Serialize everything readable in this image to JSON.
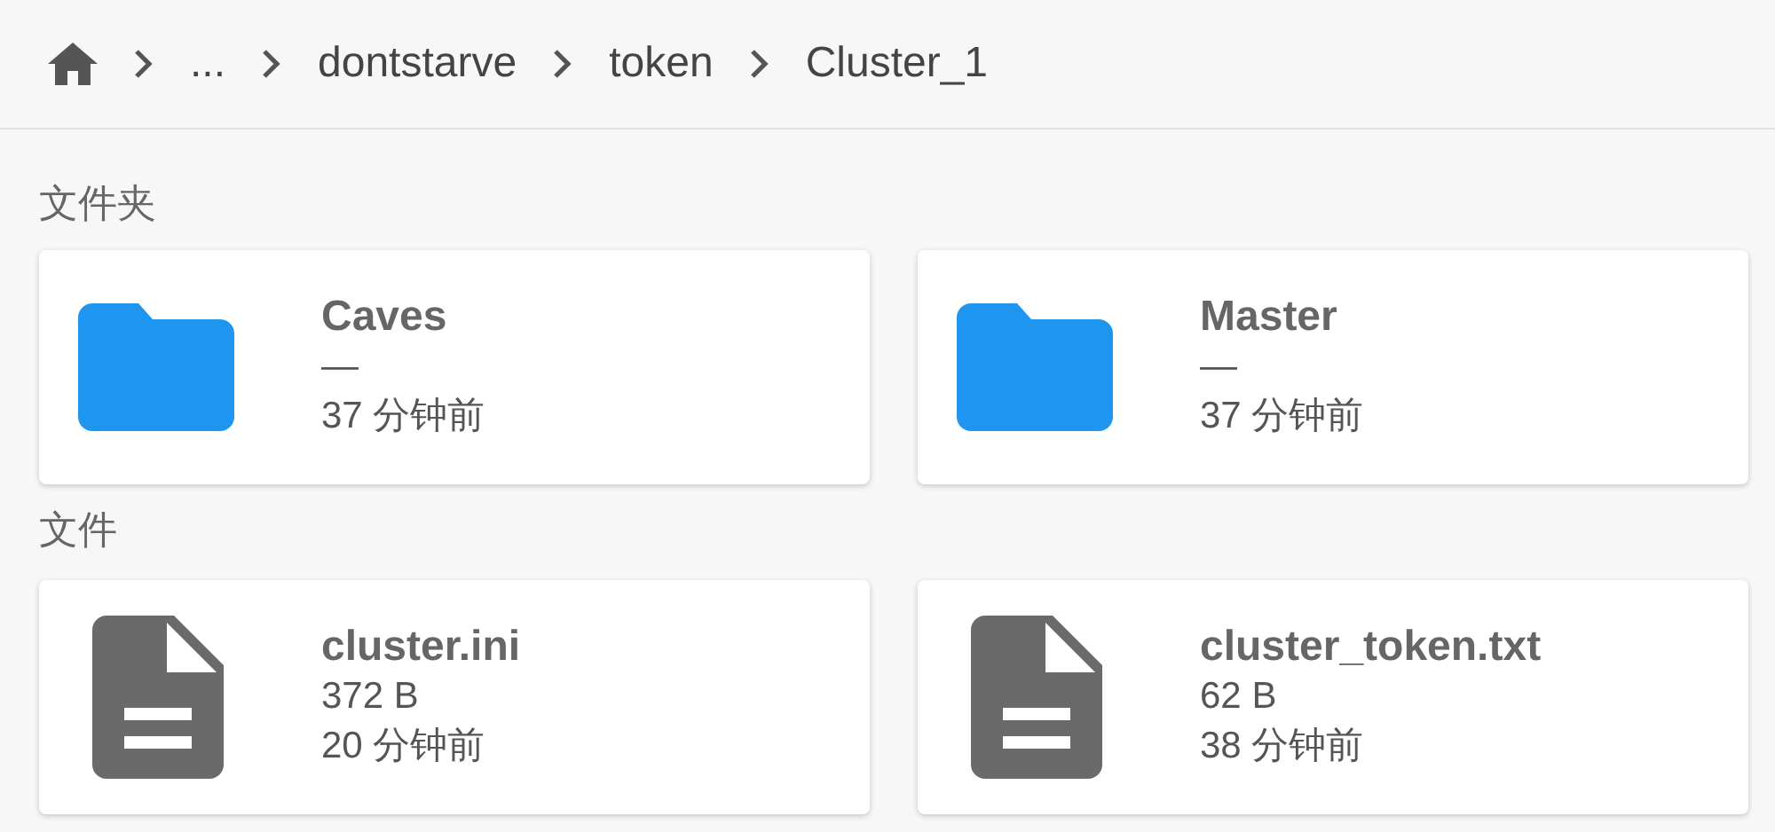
{
  "breadcrumb": [
    "...",
    "dontstarve",
    "token",
    "Cluster_1"
  ],
  "sections": [
    {
      "title": "文件夹",
      "items": [
        {
          "kind": "folder",
          "name": "Caves",
          "size": "—",
          "time": "37 分钟前"
        },
        {
          "kind": "folder",
          "name": "Master",
          "size": "—",
          "time": "37 分钟前"
        }
      ]
    },
    {
      "title": "文件",
      "items": [
        {
          "kind": "file",
          "name": "cluster.ini",
          "size": "372 B",
          "time": "20 分钟前"
        },
        {
          "kind": "file",
          "name": "cluster_token.txt",
          "size": "62 B",
          "time": "38 分钟前"
        }
      ]
    }
  ]
}
